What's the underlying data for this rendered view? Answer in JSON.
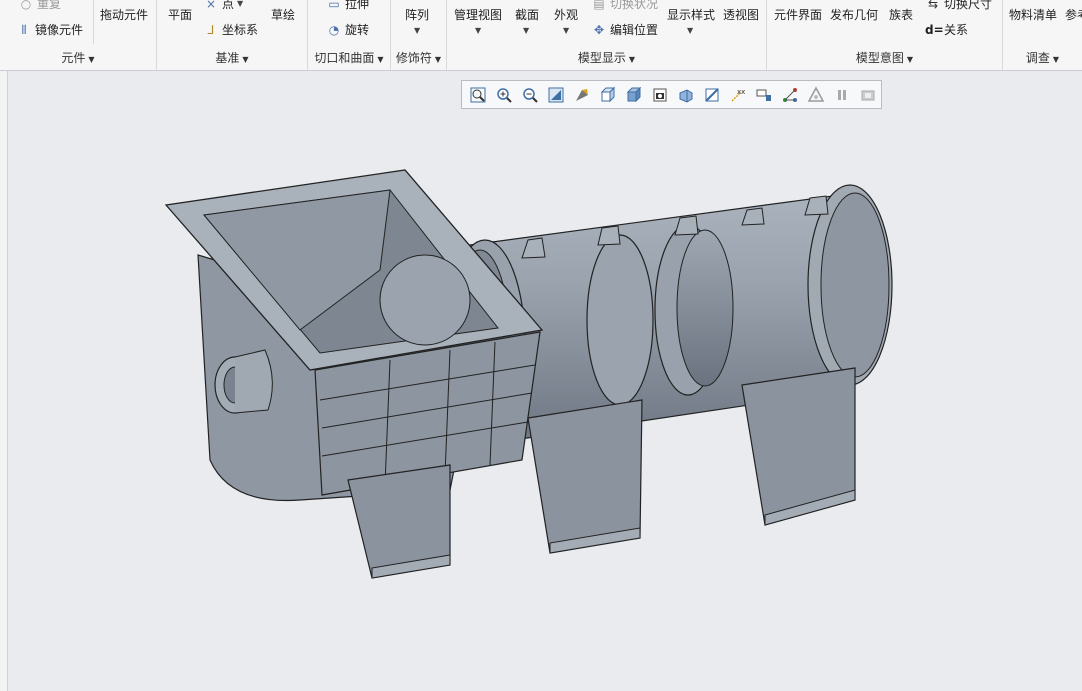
{
  "ribbon": {
    "groups": [
      {
        "id": "components",
        "label": "元件",
        "items": {
          "repeat": "重复",
          "mirror_component": "镜像元件",
          "drag_components": "拖动元件"
        }
      },
      {
        "id": "datum",
        "label": "基准",
        "items": {
          "plane": "平面",
          "point": "点",
          "csys": "坐标系",
          "sketch": "草绘"
        }
      },
      {
        "id": "cut_surface",
        "label": "切口和曲面",
        "items": {
          "extrude": "拉伸",
          "revolve": "旋转"
        }
      },
      {
        "id": "modifiers",
        "label": "修饰符",
        "items": {
          "pattern": "阵列"
        }
      },
      {
        "id": "model_display",
        "label": "模型显示",
        "items": {
          "manage_views": "管理视图",
          "section": "截面",
          "appearance": "外观",
          "switch_state": "切换状况",
          "edit_position": "编辑位置",
          "display_style": "显示样式",
          "perspective": "透视图"
        }
      },
      {
        "id": "model_intent",
        "label": "模型意图",
        "items": {
          "component_interface": "元件界面",
          "publish_geometry": "发布几何",
          "family_table": "族表",
          "switch_dimensions": "切换尺寸",
          "relations": "关系"
        }
      },
      {
        "id": "investigate",
        "label": "调查",
        "items": {
          "bom": "物料清单",
          "reference": "参考"
        }
      }
    ]
  },
  "view_toolbar": {
    "buttons": [
      "refit-icon",
      "zoom-in-icon",
      "zoom-out-icon",
      "repaint-icon",
      "orient-icon",
      "saved-views-icon",
      "display-style-icon",
      "view-manager-icon",
      "perspective-icon",
      "section-icon",
      "datum-display-icon",
      "annotation-display-icon",
      "spin-center-icon",
      "appearance-icon",
      "pause-icon",
      "stop-icon"
    ]
  }
}
